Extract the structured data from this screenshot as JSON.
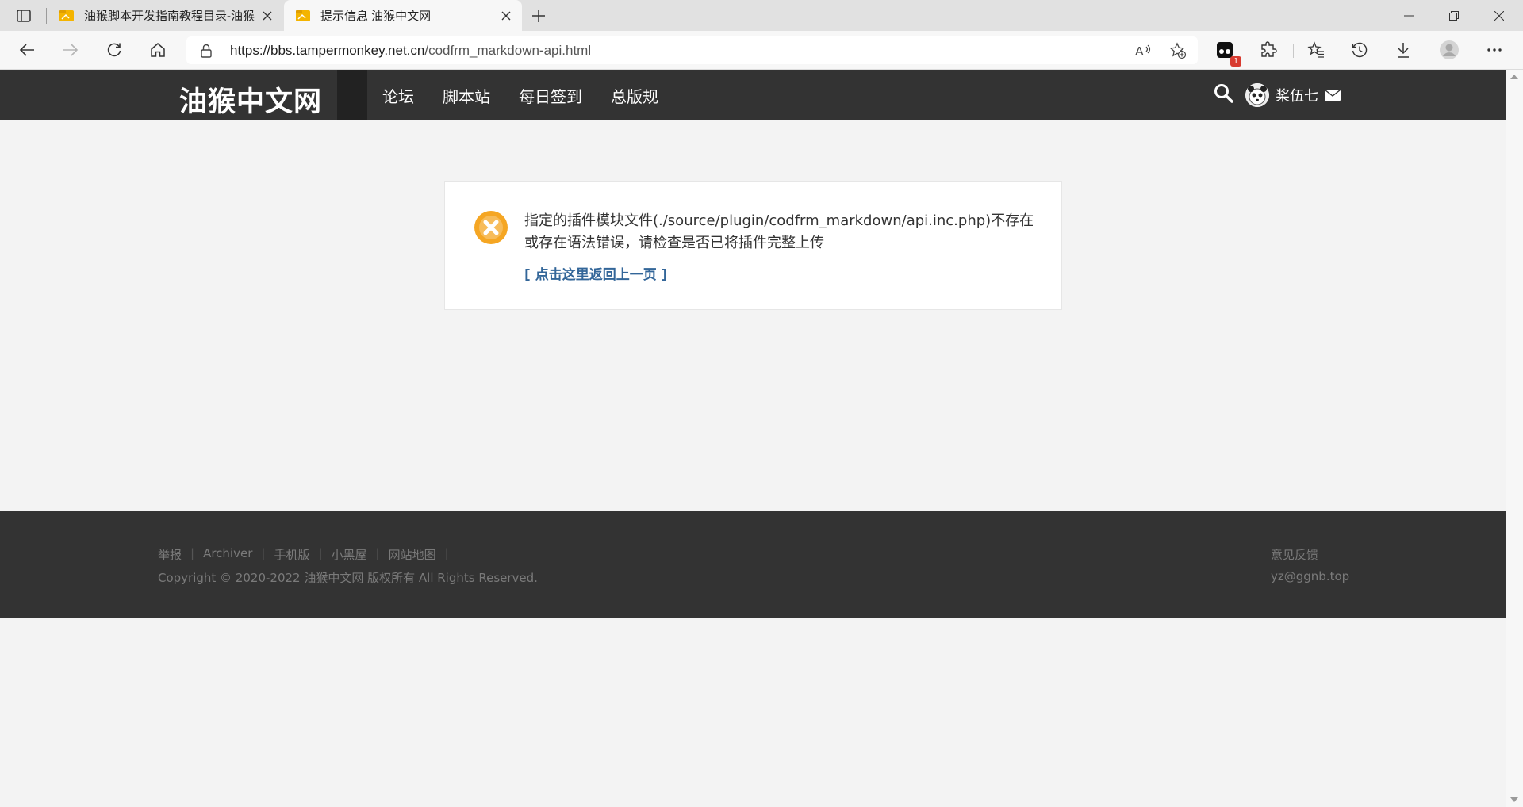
{
  "browser": {
    "tabs": [
      {
        "title": "油猴脚本开发指南教程目录-油猴",
        "active": false
      },
      {
        "title": "提示信息 油猴中文网",
        "active": true
      }
    ],
    "url_host": "https://bbs.tampermonkey.net.cn",
    "url_path": "/codfrm_markdown-api.html",
    "extension_badge": "1"
  },
  "site": {
    "logo": "油猴中文网",
    "nav": [
      "论坛",
      "脚本站",
      "每日签到",
      "总版规"
    ],
    "username": "桨伍七"
  },
  "message": {
    "text": "指定的插件模块文件(./source/plugin/codfrm_markdown/api.inc.php)不存在或存在语法错误，请检查是否已将插件完整上传",
    "link": "[ 点击这里返回上一页 ]"
  },
  "footer": {
    "links": [
      "举报",
      "Archiver",
      "手机版",
      "小黑屋",
      "网站地图"
    ],
    "copyright": "Copyright © 2020-2022 油猴中文网 版权所有 All Rights Reserved.",
    "feedback": "意见反馈",
    "email": "yz@ggnb.top"
  },
  "colors": {
    "header_bg": "#333333",
    "link": "#336699",
    "error_icon": "#f5a623"
  }
}
